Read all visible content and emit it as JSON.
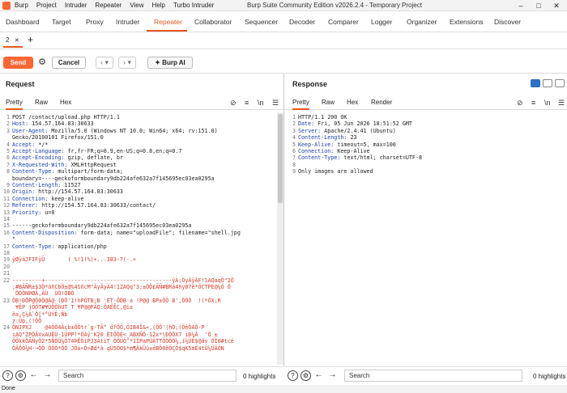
{
  "app": {
    "menu": [
      "Burp",
      "Project",
      "Intruder",
      "Repeater",
      "View",
      "Help",
      "Turbo Intruder"
    ],
    "title": "Burp Suite Community Edition v2026.2.4 - Temporary Project"
  },
  "main_tabs": [
    "Dashboard",
    "Target",
    "Proxy",
    "Intruder",
    "Repeater",
    "Collaborator",
    "Sequencer",
    "Decoder",
    "Comparer",
    "Logger",
    "Organizer",
    "Extensions",
    "Discover"
  ],
  "active_main_tab": "Repeater",
  "repeater_tab": "2",
  "toolbar": {
    "send": "Send",
    "cancel": "Cancel",
    "ai": "Burp AI"
  },
  "request": {
    "title": "Request",
    "tabs": [
      "Pretty",
      "Raw",
      "Hex"
    ],
    "lines": [
      [
        "1",
        "POST /contact/upload.php HTTP/1.1"
      ],
      [
        "2",
        "Host: 154.57.164.83:30633"
      ],
      [
        "3",
        "User-Agent: Mozilla/5.0 (Windows NT 10.0; Win64; x64; rv:151.0)"
      ],
      [
        "",
        "Gecko/20100101 Firefox/151.0"
      ],
      [
        "4",
        "Accept: */*"
      ],
      [
        "5",
        "Accept-Language: fr,fr-FR;q=0.9,en-US;q=0.8,en;q=0.7"
      ],
      [
        "6",
        "Accept-Encoding: gzip, deflate, br"
      ],
      [
        "7",
        "X-Requested-With: XMLHttpRequest"
      ],
      [
        "8",
        "Content-Type: multipart/form-data;"
      ],
      [
        "",
        "boundary=----geckoformboundary9db224afe632a7f145695ec03ea0295a"
      ],
      [
        "9",
        "Content-Length: 11527"
      ],
      [
        "10",
        "Origin: http://154.57.164.83:30633"
      ],
      [
        "11",
        "Connection: keep-alive"
      ],
      [
        "12",
        "Referer: http://154.57.164.83:30633/contact/"
      ],
      [
        "13",
        "Priority: u=0"
      ],
      [
        "14",
        ""
      ],
      [
        "15",
        "------geckoformboundary9db224afe632a7f145695ec03ea0295a"
      ],
      [
        "16",
        "Content-Disposition: form-data; name=\"uploadFile\"; filename=\"shell.jpg"
      ],
      [
        "",
        "\""
      ],
      [
        "17",
        "Content-Type: application/php"
      ],
      [
        "18",
        ""
      ],
      [
        "19",
        "ÿØÿàJFIFÿÛ       ( %!1!%)+...383-7(-.+"
      ],
      [
        "20",
        ""
      ],
      [
        "21",
        ""
      ],
      [
        "22",
        "---------+---------------------------------------ÿÀ;ÖyÄÿÄF!1AQaqÖ\"2Ö"
      ],
      [
        "",
        ";#BÃÑR±$3Ö*áñCbÖ±@%4SñcM\"ÄyÄyÄ4!1ZAQq\"3;±ÖÖ£ÃÑ#BRá4ñy07ë*ÖCTPE@¼Ö Ö"
      ],
      [
        "",
        " ÖDÖNÞØÃ,ÃÜ  ÜÖ!ÖBÖ"
      ],
      [
        "23",
        "ÖB!ÐÖP@Ö0Ö@Ä@ (ÐÖ'1!hPÖTB;B 'ET-ÖDB a !P@@ BP±ÖÖ B',ÖÖÖ  !(*ÖX;R"
      ],
      [
        "",
        " ¥ÊP jÖÖT#¥ÜÖÖhUT T ¥P@@FÄQ:ÖAÊÊC,@i±"
      ],
      [
        "",
        "ëa,Ç¼À`Ö[*°ÜÝÊ;Ñb"
      ],
      [
        "",
        "z:Üp,(!ÖÖ"
      ],
      [
        "24",
        "ÖNJPXJ    @4ÖÖ4Äçb±ÖÖtr`g-TÃ° dfÖÖ,ÖIB4Î&«,(ÖÖ'(hÖ;(ÖéÖAÖ-P"
      ],
      [
        "",
        "iAQ\"ZPÖÄVxAUÉÜ-1ÜPP!*ÖAÿ'K20 ÉIÖÖE<_ABXÑÖ-12x*\\ÐÖÖX7 iÐ¼Å  'Ö ±"
      ],
      [
        "",
        "ÖÖkkÖÃÑyÖ2*5ÑÖÜ¼Ö74ÞÊÖiPJ3ÃtiT ÖÖÜÖ^*1ÌPaPÜÄTTÖÖÖÖ¼,í¼ÜÉ$@áv ÖÍ0#tcé"
      ],
      [
        "",
        "ÖÄÖÖ¼H-¬ÖÖ ÖÖÖ*ÖÖ JÖ±<Ö>Ød*à qÜ5Ö0$*m¶ÄkÜü±éBÖ0ëÖÇÖ$qK5mË4tÜ¼ÜÄÖN"
      ]
    ]
  },
  "response": {
    "title": "Response",
    "tabs": [
      "Pretty",
      "Raw",
      "Hex",
      "Render"
    ],
    "lines": [
      [
        "1",
        "HTTP/1.1 200 OK"
      ],
      [
        "2",
        "Date: Fri, 05 Jun 2026 18:51:52 GMT"
      ],
      [
        "3",
        "Server: Apache/2.4.41 (Ubuntu)"
      ],
      [
        "4",
        "Content-Length: 23"
      ],
      [
        "5",
        "Keep-Alive: timeout=5, max=100"
      ],
      [
        "6",
        "Connection: Keep-Alive"
      ],
      [
        "7",
        "Content-Type: text/html; charset=UTF-8"
      ],
      [
        "8",
        ""
      ],
      [
        "9",
        "Only images are allowed"
      ]
    ]
  },
  "search": {
    "placeholder": "Search",
    "highlights": "0 highlights"
  },
  "status": "Done"
}
